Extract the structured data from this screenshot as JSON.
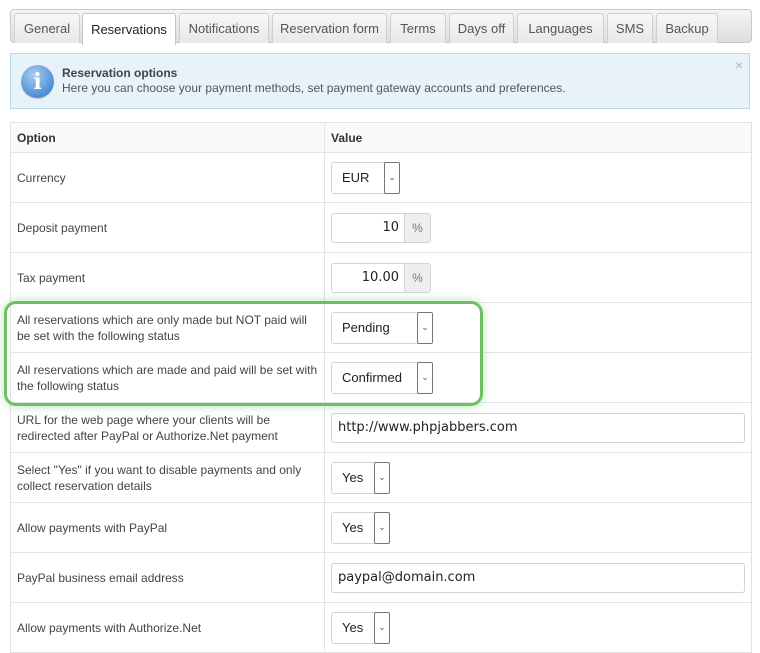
{
  "tabs": [
    {
      "label": "General",
      "active": false
    },
    {
      "label": "Reservations",
      "active": true
    },
    {
      "label": "Notifications",
      "active": false
    },
    {
      "label": "Reservation form",
      "active": false
    },
    {
      "label": "Terms",
      "active": false
    },
    {
      "label": "Days off",
      "active": false
    },
    {
      "label": "Languages",
      "active": false
    },
    {
      "label": "SMS",
      "active": false
    },
    {
      "label": "Backup",
      "active": false
    }
  ],
  "info": {
    "icon": "info-icon",
    "icon_glyph": "i",
    "title": "Reservation options",
    "text": "Here you can choose your payment methods, set payment gateway accounts and preferences.",
    "close_glyph": "×"
  },
  "table": {
    "headers": {
      "option": "Option",
      "value": "Value"
    },
    "rows": [
      {
        "label": "Currency",
        "type": "select",
        "value": "EUR"
      },
      {
        "label": "Deposit payment",
        "type": "percent",
        "value": "10",
        "unit": "%"
      },
      {
        "label": "Tax payment",
        "type": "percent",
        "value": "10.00",
        "unit": "%"
      },
      {
        "label": "All reservations which are only made but NOT paid will be set with the following status",
        "type": "select",
        "value": "Pending"
      },
      {
        "label": "All reservations which are made and paid will be set with the following status",
        "type": "select",
        "value": "Confirmed"
      },
      {
        "label": "URL for the web page where your clients will be redirected after PayPal or Authorize.Net payment",
        "type": "text",
        "value": "http://www.phpjabbers.com"
      },
      {
        "label": "Select \"Yes\" if you want to disable payments and only collect reservation details",
        "type": "select",
        "value": "Yes"
      },
      {
        "label": "Allow payments with PayPal",
        "type": "select",
        "value": "Yes"
      },
      {
        "label": "PayPal business email address",
        "type": "text",
        "value": "paypal@domain.com"
      },
      {
        "label": "Allow payments with Authorize.Net",
        "type": "select",
        "value": "Yes"
      }
    ]
  },
  "select_arrow_glyph": "⌄",
  "highlight_color": "#6cc063"
}
